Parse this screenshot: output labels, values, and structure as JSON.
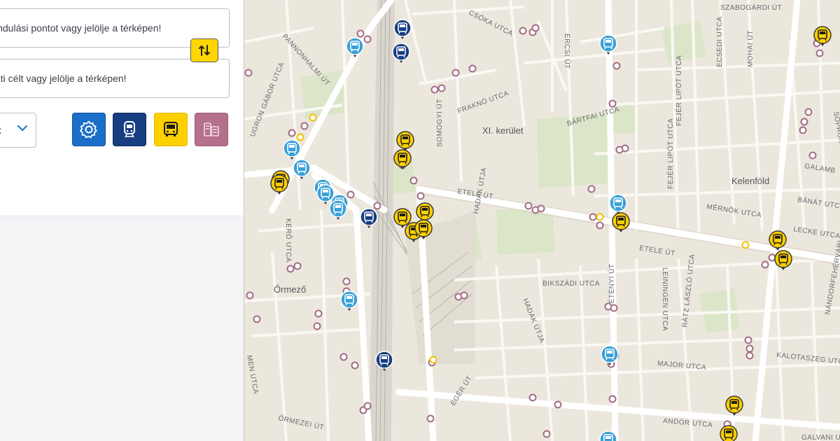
{
  "planner": {
    "from_placeholder": "indulási pontot vagy jelölje a térképen!",
    "to_placeholder": "úti célt vagy jelölje a térképen!",
    "mode_value": "st",
    "filters": [
      {
        "name": "settings",
        "icon": "gear-icon",
        "color": "#1a6fc9"
      },
      {
        "name": "suburban-rail",
        "icon": "suburban-rail-icon",
        "color": "#173e80"
      },
      {
        "name": "bus",
        "icon": "bus-icon",
        "color": "#ffd000"
      },
      {
        "name": "other",
        "icon": "other-transport-icon",
        "color": "#b5708e"
      }
    ]
  },
  "map": {
    "districts": {
      "xi": "XI. kerület",
      "kelenfold": "Kelenföld",
      "ormezo": "Őrmező"
    },
    "streets": {
      "csoka": "CSÓKA UTCA",
      "pannonhalmi": "PANNONHALMI ÚT",
      "ugron": "UGRON GÁBOR UTCA",
      "ercsi": "ERCSI ÚT",
      "fraknoe": "FRAKNÓ UTCA",
      "somogyi": "SOMOGYI ÚT",
      "bartfai": "BÁRTFAI UTCA",
      "fejer": "FEJÉR LIPÓT UTCA",
      "ecsedi": "ECSEDI UTCA",
      "mohai": "MOHAI ÚT",
      "bocskai": "SZABOGÁRDI ÚT",
      "etele1": "ETELE ÚT",
      "etele2": "ETELE ÚT",
      "merno": "MÉRNÖK UTCA",
      "banat": "BÁNÁT UTCA",
      "lecke": "LECKE UTCA",
      "galamb": "GALAMB",
      "kero": "KERŐ UTCA",
      "hadak1": "HADAK ÚTJA",
      "hadak2": "HADAK ÚTJA",
      "bikszadi": "BIKSZÁDI UTCA",
      "tetenyi": "TÉTÉNYI ÚT",
      "leiningen": "LEININGEN UTCA",
      "ratz": "RÁTZ LÁSZLÓ UTCA",
      "major": "MAJOR UTCA",
      "kalotaszeg": "KALOTASZEG UTCA",
      "nandorfe": "NÁNDORFEHÉRVÁRI",
      "egeru": "EGÉR ÚT",
      "andor": "ANDOR UTCA",
      "galvani": "GALVANI U",
      "ormezei": "ŐRMEZEI ÚT",
      "men": "MEN UTCA",
      "sopron": "SOPRON"
    }
  },
  "colors": {
    "accent_blue": "#1a6fc9",
    "suburban_dark_blue": "#173e80",
    "bus_yellow": "#ffd000",
    "tram_light_blue": "#3aa0d8",
    "stop_purple": "#a36b86",
    "map_background": "#ece7dd",
    "park_green": "#dbe6c8",
    "railway_gray": "#c8c6c0"
  }
}
